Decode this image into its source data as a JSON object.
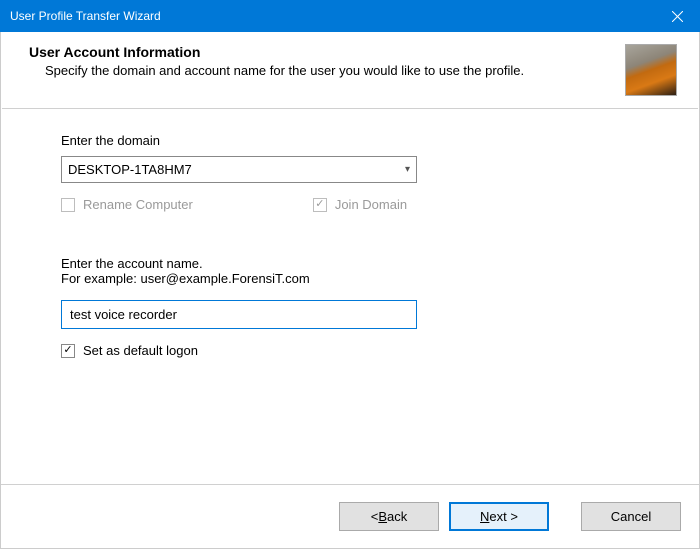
{
  "window": {
    "title": "User Profile Transfer Wizard"
  },
  "header": {
    "title": "User Account Information",
    "description": "Specify the domain and account name for the user you would like to use the profile.",
    "icon_name": "profile-icon"
  },
  "domain": {
    "label": "Enter the domain",
    "value": "DESKTOP-1TA8HM7",
    "rename_label": "Rename Computer",
    "rename_checked": false,
    "rename_enabled": false,
    "join_label": "Join Domain",
    "join_checked": true,
    "join_enabled": false
  },
  "account": {
    "label": "Enter the account name.",
    "example": "For example: user@example.ForensiT.com",
    "value": "test voice recorder",
    "default_logon_label": "Set as default logon",
    "default_logon_checked": true
  },
  "buttons": {
    "back_prefix": "< ",
    "back_u": "B",
    "back_rest": "ack",
    "next_u": "N",
    "next_rest": "ext >",
    "cancel": "Cancel"
  }
}
